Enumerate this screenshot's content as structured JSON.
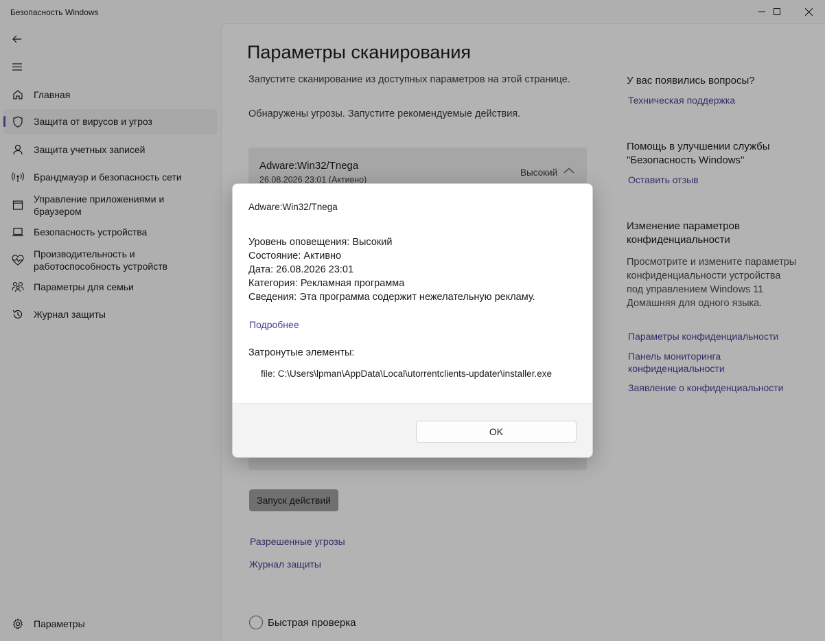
{
  "window": {
    "title": "Безопасность Windows"
  },
  "sidebar": {
    "items": [
      {
        "label": "Главная",
        "icon": "home-icon"
      },
      {
        "label": "Защита от вирусов и угроз",
        "icon": "shield-icon",
        "active": true
      },
      {
        "label": "Защита учетных записей",
        "icon": "person-icon"
      },
      {
        "label": "Брандмауэр и безопасность сети",
        "icon": "wifi-antenna-icon"
      },
      {
        "label": "Управление приложениями и браузером",
        "icon": "app-window-icon"
      },
      {
        "label": "Безопасность устройства",
        "icon": "laptop-icon"
      },
      {
        "label": "Производительность и работоспособность устройств",
        "icon": "heart-pulse-icon"
      },
      {
        "label": "Параметры для семьи",
        "icon": "family-icon"
      },
      {
        "label": "Журнал защиты",
        "icon": "history-icon"
      }
    ],
    "settings_label": "Параметры"
  },
  "main": {
    "title": "Параметры сканирования",
    "description": "Запустите сканирование из доступных параметров на этой странице.",
    "threats_notice": "Обнаружены угрозы. Запустите рекомендуемые действия.",
    "threat": {
      "name": "Adware:Win32/Tnega",
      "date": "26.08.2026 23:01 (Активно)",
      "level": "Высокий"
    },
    "action_button": "Запуск действий",
    "links": {
      "allowed": "Разрешенные угрозы",
      "history": "Журнал защиты"
    },
    "quick_scan": "Быстрая проверка"
  },
  "right_panel": {
    "questions_heading": "У вас появились вопросы?",
    "support_link": "Техническая поддержка",
    "improve_heading": "Помощь в улучшении службы \"Безопасность Windows\"",
    "feedback_link": "Оставить отзыв",
    "privacy_heading": "Изменение параметров конфиденциальности",
    "privacy_text": "Просмотрите и измените параметры конфиденциальности устройства под управлением Windows 11 Домашняя для одного языка.",
    "privacy_settings_link": "Параметры конфиденциальности",
    "privacy_dashboard_link": "Панель мониторинга конфиденциальности",
    "privacy_statement_link": "Заявление о конфиденциальности"
  },
  "dialog": {
    "threat_name": "Adware:Win32/Tnega",
    "alert_level": "Уровень оповещения: Высокий",
    "status": "Состояние: Активно",
    "date": "Дата: 26.08.2026 23:01",
    "category": "Категория: Рекламная программа",
    "details": "Сведения: Эта программа содержит нежелательную рекламу.",
    "more_link": "Подробнее",
    "affected_label": "Затронутые элементы:",
    "affected_file": "file: C:\\Users\\lpman\\AppData\\Local\\utorrentclients-updater\\installer.exe",
    "ok_button": "OK"
  },
  "colors": {
    "link": "#4a3d8f",
    "accent": "#6b4ba8"
  }
}
